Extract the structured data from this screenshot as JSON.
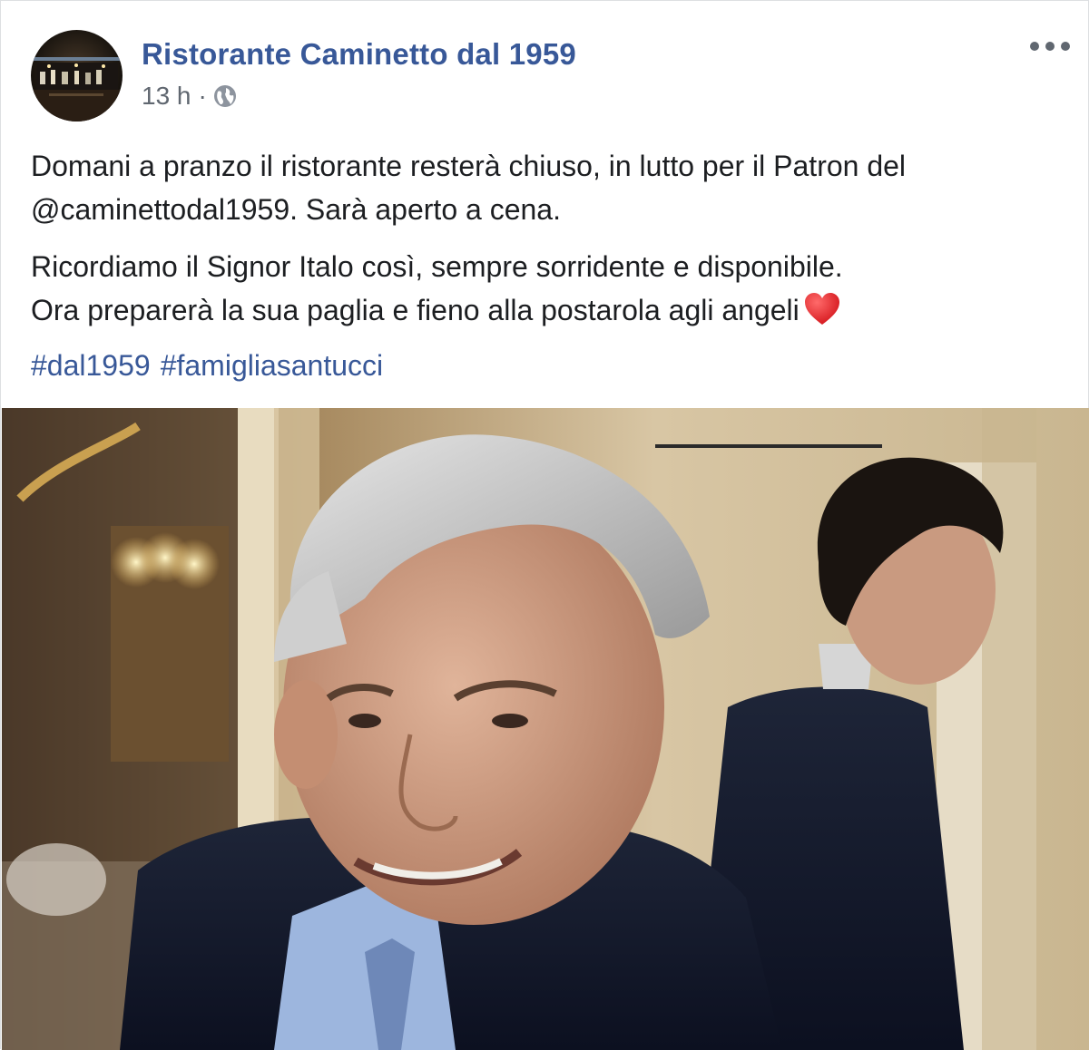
{
  "post": {
    "page_name": "Ristorante Caminetto dal 1959",
    "time_ago": "13 h",
    "separator": "·",
    "privacy_icon": "globe-icon",
    "more_icon": "more-options-icon",
    "paragraphs": {
      "first": {
        "line1": "Domani a pranzo il ristorante resterà chiuso, in lutto per il Patron del",
        "line2": "@caminettodal1959. Sarà aperto a cena."
      },
      "second": {
        "line1": "Ricordiamo il Signor Italo così, sempre sorridente e disponibile.",
        "line2": "Ora preparerà la sua paglia e fieno alla postarola agli angeli"
      }
    },
    "emoji": "red-heart",
    "hashtags": [
      "#dal1959",
      "#famigliasantucci"
    ]
  },
  "colors": {
    "link_blue": "#385898",
    "text": "#1c1e21",
    "secondary_text": "#606770",
    "heart_red": "#e0262d"
  }
}
